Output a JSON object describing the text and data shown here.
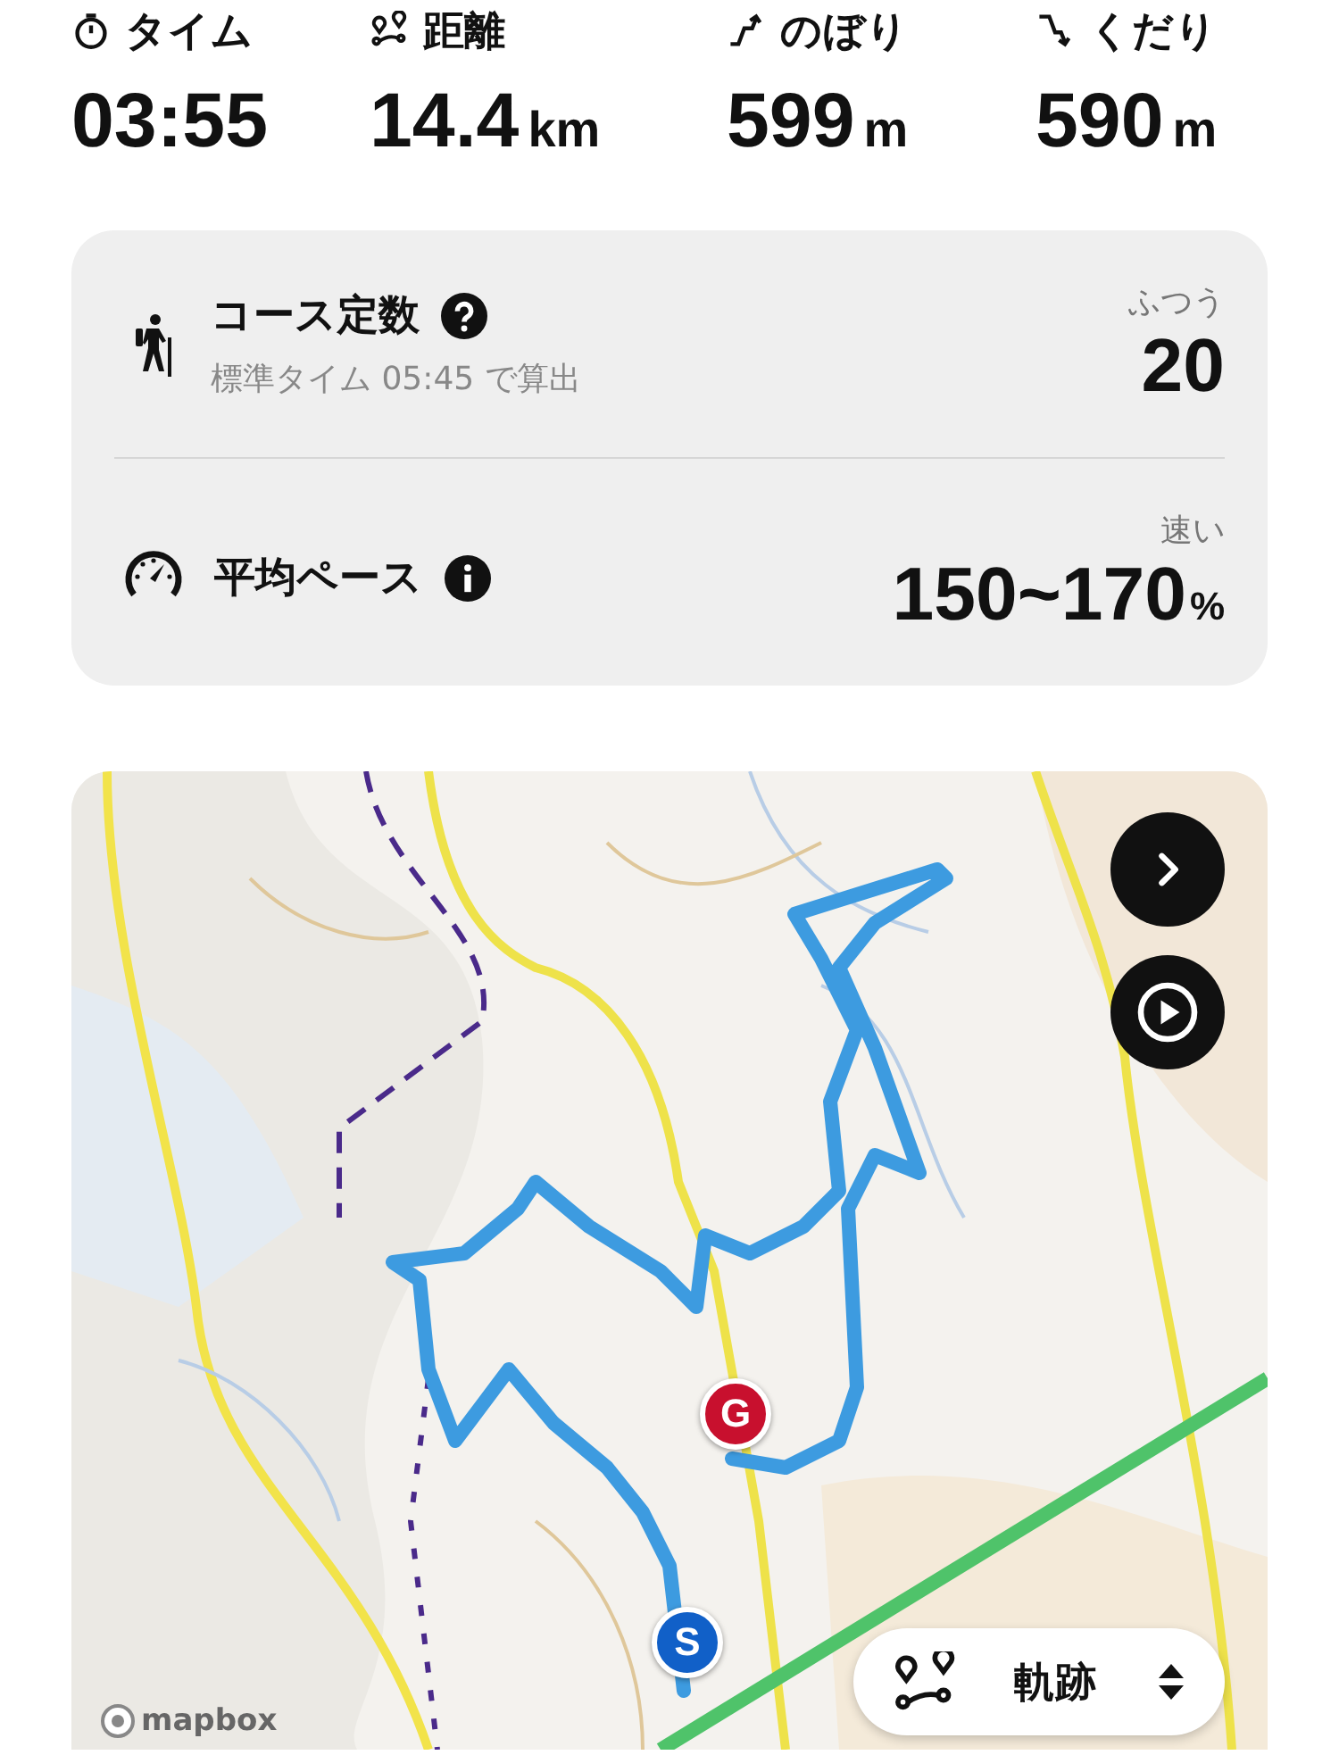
{
  "stats": [
    {
      "kind": "time",
      "label": "タイム",
      "value": "03:55"
    },
    {
      "kind": "distance",
      "label": "距離",
      "value": "14.4",
      "unit": "km"
    },
    {
      "kind": "ascent",
      "label": "のぼり",
      "value": "599",
      "unit": "m"
    },
    {
      "kind": "descent",
      "label": "くだり",
      "value": "590",
      "unit": "m"
    }
  ],
  "summary": [
    {
      "kind": "course",
      "title": "コース定数",
      "subtitle": "標準タイム 05:45 で算出",
      "rating": "ふつう",
      "value": "20"
    },
    {
      "kind": "pace",
      "title": "平均ペース",
      "rating": "速い",
      "value": "150~170",
      "unit": "%"
    }
  ],
  "map": {
    "kind": "picture",
    "markers": [
      {
        "label": "G",
        "color": "#c8102e"
      },
      {
        "label": "S",
        "color": "#1160c8"
      }
    ],
    "controls": [
      {
        "kind": "next"
      },
      {
        "kind": "play"
      }
    ],
    "layer_button": {
      "label": "軌跡"
    },
    "attribution": "mapbox"
  }
}
